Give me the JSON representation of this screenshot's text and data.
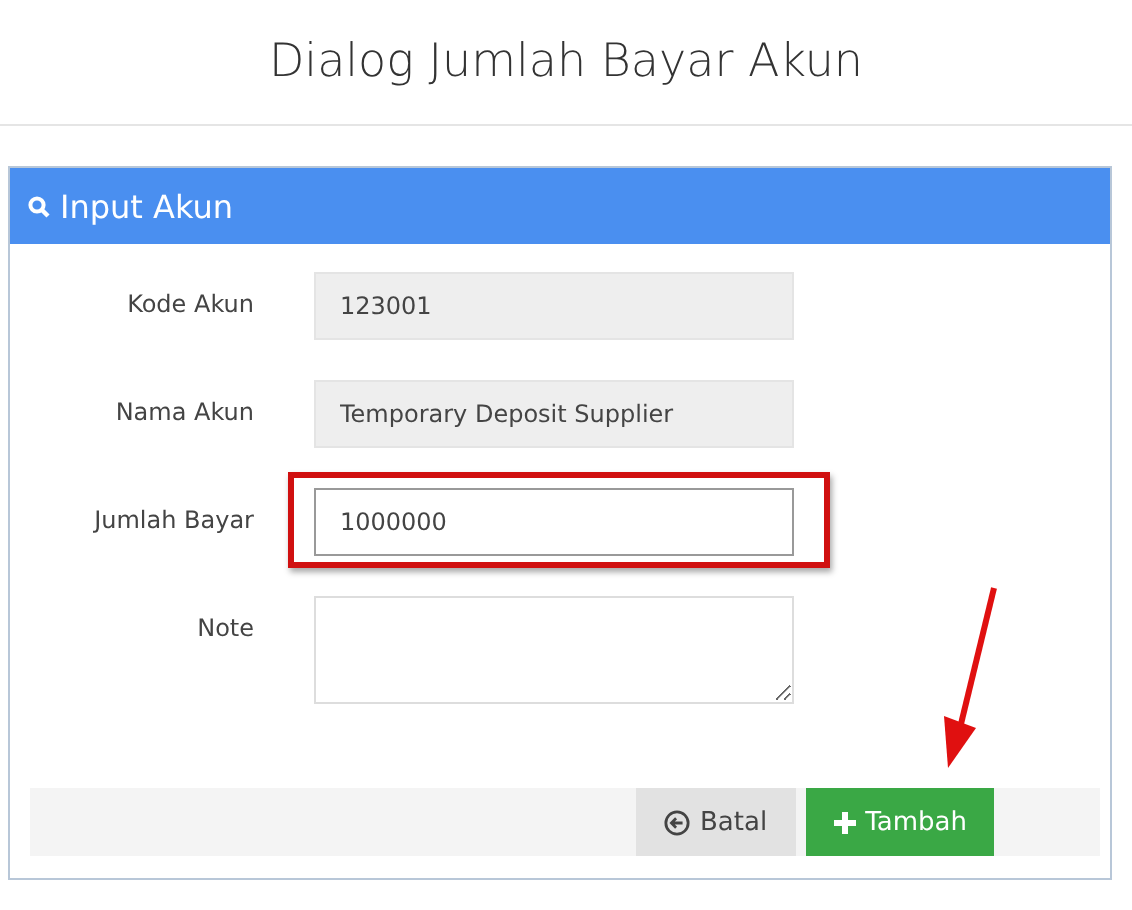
{
  "dialog": {
    "title": "Dialog Jumlah Bayar Akun"
  },
  "panel": {
    "title": "Input Akun"
  },
  "fields": [
    {
      "label": "Kode Akun",
      "kind": "input",
      "value": "123001",
      "readonly": true,
      "highlighted": false
    },
    {
      "label": "Nama Akun",
      "kind": "input",
      "value": "Temporary Deposit Supplier",
      "readonly": true,
      "highlighted": false
    },
    {
      "label": "Jumlah Bayar",
      "kind": "input",
      "value": "1000000",
      "readonly": false,
      "highlighted": true
    },
    {
      "label": "Note",
      "kind": "textarea",
      "readonly": false,
      "highlighted": false
    }
  ],
  "buttons": [
    {
      "label": "Batal",
      "kind": "cancel"
    },
    {
      "label": "Tambah",
      "kind": "submit"
    }
  ]
}
